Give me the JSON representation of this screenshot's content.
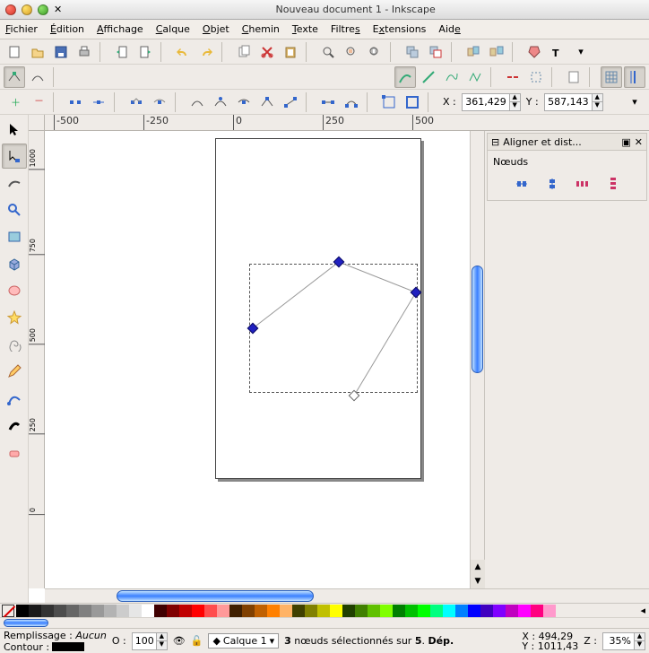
{
  "window": {
    "title": "Nouveau document 1 - Inkscape"
  },
  "menu": {
    "file": "Fichier",
    "edit": "Édition",
    "view": "Affichage",
    "layer": "Calque",
    "object": "Objet",
    "path": "Chemin",
    "text": "Texte",
    "filters": "Filtres",
    "extensions": "Extensions",
    "help": "Aide"
  },
  "coords": {
    "x_label": "X :",
    "x_value": "361,429",
    "y_label": "Y :",
    "y_value": "587,143"
  },
  "ruler_h": [
    "-500",
    "-250",
    "0",
    "250",
    "500"
  ],
  "ruler_v": [
    "1000",
    "750",
    "500",
    "250",
    "0"
  ],
  "dock": {
    "title": "Aligner et dist...",
    "section": "Nœuds"
  },
  "status": {
    "fill_label": "Remplissage :",
    "fill_value": "Aucun",
    "stroke_label": "Contour :",
    "opacity_label": "O :",
    "opacity_value": "100",
    "layer_name": "Calque 1",
    "message": "3 nœuds sélectionnés sur 5. Dép.",
    "cursor_x_label": "X :",
    "cursor_x": "494,29",
    "cursor_y_label": "Y :",
    "cursor_y": "1011,43",
    "zoom_label": "Z :",
    "zoom_value": "35%"
  },
  "palette": [
    "#000000",
    "#1a1a1a",
    "#333333",
    "#4d4d4d",
    "#666666",
    "#808080",
    "#999999",
    "#b3b3b3",
    "#cccccc",
    "#e6e6e6",
    "#ffffff",
    "#400000",
    "#800000",
    "#c00000",
    "#ff0000",
    "#ff4d4d",
    "#ff9999",
    "#402000",
    "#804000",
    "#c06000",
    "#ff8000",
    "#ffb366",
    "#404000",
    "#808000",
    "#c0c000",
    "#ffff00",
    "#204000",
    "#408000",
    "#60c000",
    "#80ff00",
    "#008000",
    "#00c000",
    "#00ff00",
    "#00ff80",
    "#00ffff",
    "#0080ff",
    "#0000ff",
    "#4000c0",
    "#8000ff",
    "#c000c0",
    "#ff00ff",
    "#ff0080",
    "#ff99cc"
  ]
}
